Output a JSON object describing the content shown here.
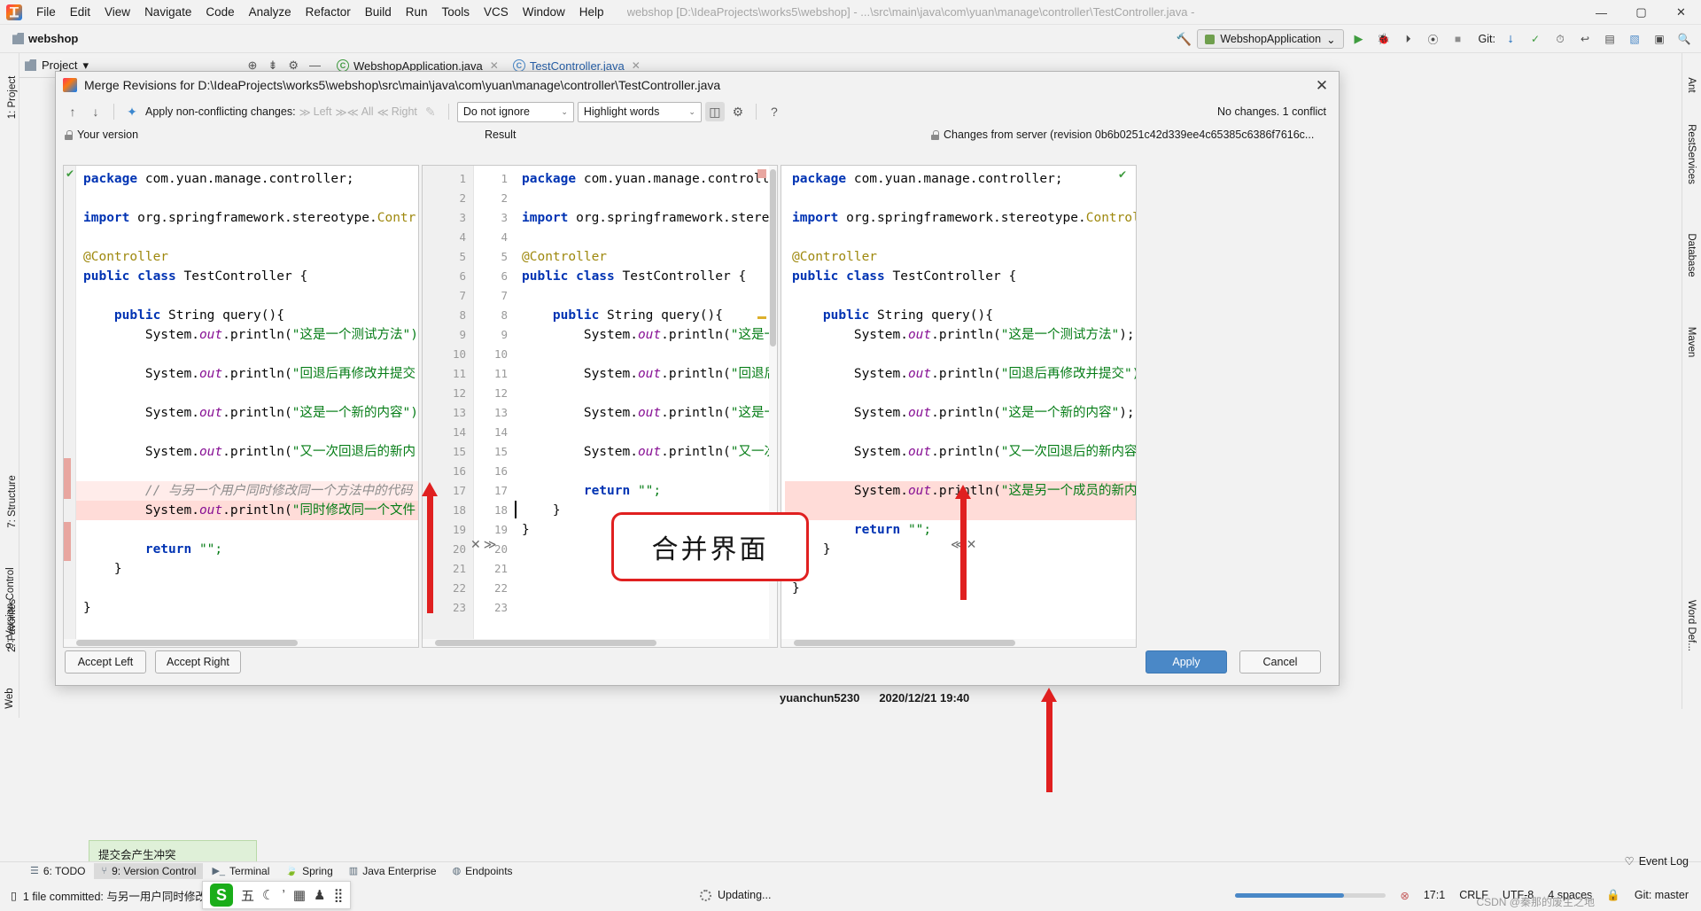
{
  "menubar": {
    "logo_icon": "intellij-logo-icon",
    "items": [
      "File",
      "Edit",
      "View",
      "Navigate",
      "Code",
      "Analyze",
      "Refactor",
      "Build",
      "Run",
      "Tools",
      "VCS",
      "Window",
      "Help"
    ],
    "window_title": "webshop [D:\\IdeaProjects\\works5\\webshop] - ...\\src\\main\\java\\com\\yuan\\manage\\controller\\TestController.java - IntelliJ IDEA",
    "minimize": "—",
    "maximize": "▢",
    "close": "✕"
  },
  "navbar": {
    "breadcrumb": "webshop",
    "run_config": "WebshopApplication",
    "git_label": "Git:",
    "icons": [
      "hammer-icon",
      "run-icon",
      "debug-icon",
      "coverage-icon",
      "profile-icon",
      "stop-icon",
      "git-update-icon",
      "git-commit-icon",
      "git-history-icon",
      "git-revert-icon",
      "search-everywhere-icon",
      "settings-icon"
    ]
  },
  "project_tool": {
    "title": "Project",
    "caret": "▾"
  },
  "editor_tabs": [
    {
      "label": "WebshopApplication.java",
      "icon": "java-class-icon",
      "active": false,
      "close": "✕"
    },
    {
      "label": "TestController.java",
      "icon": "java-class-icon",
      "active": true,
      "close": "✕"
    }
  ],
  "left_strip": [
    "1: Project",
    "7: Structure",
    "9: Version Control",
    "2: Favorites",
    "Web"
  ],
  "left_strip_bottom_labels": [
    "7: Structure",
    "2: Favorites"
  ],
  "right_strip": [
    "Ant",
    "RestServices",
    "Database",
    "Maven"
  ],
  "right_strip_bottom": [
    "Word Def..."
  ],
  "dialog": {
    "title": "Merge Revisions for D:\\IdeaProjects\\works5\\webshop\\src\\main\\java\\com\\yuan\\manage\\controller\\TestController.java",
    "logo_icon": "intellij-logo-icon",
    "close_icon": "✕",
    "toolbar": {
      "prev_icon": "arrow-up-icon",
      "next_icon": "arrow-down-icon",
      "magic_icon": "apply-all-icon",
      "apply_label": "Apply non-conflicting changes:",
      "left_label": "Left",
      "all_label": "All",
      "right_label": "Right",
      "wand_icon": "magic-wand-icon",
      "ignore_select": "Do not ignore",
      "highlight_select": "Highlight words",
      "columns_icon": "collapse-unchanged-icon",
      "gear_icon": "gear-icon",
      "help_icon": "?",
      "conflict_status": "No changes. 1 conflict"
    },
    "panes": {
      "left_title": "Your version",
      "left_lock_icon": "lock-icon",
      "result_title": "Result",
      "right_title": "Changes from server (revision 0b6b0251c42d339ee4c65385c6386f7616c...",
      "right_lock_icon": "lock-icon"
    },
    "buttons": {
      "accept_left": "Accept Left",
      "accept_right": "Accept Right",
      "apply": "Apply",
      "cancel": "Cancel"
    },
    "conflict_actions": {
      "left_x": "✕",
      "left_chevrons": "≫",
      "right_chevrons": "≪",
      "right_x": "✕"
    }
  },
  "code": {
    "left_lines": [
      {
        "n": "",
        "segs": [
          {
            "t": "package ",
            "c": "kw"
          },
          {
            "t": "com.yuan.manage.controller;",
            "c": "pln"
          }
        ]
      },
      {
        "n": "",
        "segs": []
      },
      {
        "n": "",
        "segs": [
          {
            "t": "import ",
            "c": "kw"
          },
          {
            "t": "org.springframework.stereotype.",
            "c": "pln"
          },
          {
            "t": "Contr",
            "c": "ann"
          }
        ]
      },
      {
        "n": "",
        "segs": []
      },
      {
        "n": "",
        "segs": [
          {
            "t": "@Controller",
            "c": "ann"
          }
        ]
      },
      {
        "n": "",
        "segs": [
          {
            "t": "public class ",
            "c": "kw"
          },
          {
            "t": "TestController {",
            "c": "pln"
          }
        ]
      },
      {
        "n": "",
        "segs": []
      },
      {
        "n": "",
        "segs": [
          {
            "t": "    public ",
            "c": "kw"
          },
          {
            "t": "String query(){",
            "c": "pln"
          }
        ]
      },
      {
        "n": "",
        "segs": [
          {
            "t": "        System.",
            "c": "pln"
          },
          {
            "t": "out",
            "c": "fld"
          },
          {
            "t": ".println(",
            "c": "pln"
          },
          {
            "t": "\"这是一个测试方法\")",
            "c": "str"
          }
        ]
      },
      {
        "n": "",
        "segs": []
      },
      {
        "n": "",
        "segs": [
          {
            "t": "        System.",
            "c": "pln"
          },
          {
            "t": "out",
            "c": "fld"
          },
          {
            "t": ".println(",
            "c": "pln"
          },
          {
            "t": "\"回退后再修改并提交",
            "c": "str"
          }
        ]
      },
      {
        "n": "",
        "segs": []
      },
      {
        "n": "",
        "segs": [
          {
            "t": "        System.",
            "c": "pln"
          },
          {
            "t": "out",
            "c": "fld"
          },
          {
            "t": ".println(",
            "c": "pln"
          },
          {
            "t": "\"这是一个新的内容\")",
            "c": "str"
          }
        ]
      },
      {
        "n": "",
        "segs": []
      },
      {
        "n": "",
        "segs": [
          {
            "t": "        System.",
            "c": "pln"
          },
          {
            "t": "out",
            "c": "fld"
          },
          {
            "t": ".println(",
            "c": "pln"
          },
          {
            "t": "\"又一次回退后的新内",
            "c": "str"
          }
        ]
      },
      {
        "n": "",
        "segs": []
      },
      {
        "n": "",
        "segs": [
          {
            "t": "        // 与另一个用户同时修改同一个方法中的代码",
            "c": "cmt"
          }
        ],
        "hl": "soft"
      },
      {
        "n": "",
        "segs": [
          {
            "t": "        System.",
            "c": "pln"
          },
          {
            "t": "out",
            "c": "fld"
          },
          {
            "t": ".println(",
            "c": "pln"
          },
          {
            "t": "\"同时修改同一个文件",
            "c": "str"
          }
        ],
        "hl": "hard"
      },
      {
        "n": "",
        "segs": []
      },
      {
        "n": "",
        "segs": [
          {
            "t": "        return ",
            "c": "kw"
          },
          {
            "t": "\"\";",
            "c": "str"
          }
        ]
      },
      {
        "n": "",
        "segs": [
          {
            "t": "    }",
            "c": "pln"
          }
        ]
      },
      {
        "n": "",
        "segs": []
      },
      {
        "n": "",
        "segs": [
          {
            "t": "}",
            "c": "pln"
          }
        ]
      }
    ],
    "result_lines": [
      {
        "n": "1",
        "segs": [
          {
            "t": "package ",
            "c": "kw"
          },
          {
            "t": "com.yuan.manage.controller;",
            "c": "pln"
          }
        ]
      },
      {
        "n": "2",
        "segs": []
      },
      {
        "n": "3",
        "segs": [
          {
            "t": "import ",
            "c": "kw"
          },
          {
            "t": "org.springframework.stereotype.",
            "c": "pln"
          },
          {
            "t": "Controll",
            "c": "ann"
          }
        ]
      },
      {
        "n": "4",
        "segs": []
      },
      {
        "n": "5",
        "segs": [
          {
            "t": "@Controller",
            "c": "ann"
          }
        ]
      },
      {
        "n": "6",
        "segs": [
          {
            "t": "public class ",
            "c": "kw"
          },
          {
            "t": "TestController {",
            "c": "pln"
          }
        ]
      },
      {
        "n": "7",
        "segs": []
      },
      {
        "n": "8",
        "segs": [
          {
            "t": "    public ",
            "c": "kw"
          },
          {
            "t": "String query(){",
            "c": "pln"
          }
        ]
      },
      {
        "n": "9",
        "segs": [
          {
            "t": "        System.",
            "c": "pln"
          },
          {
            "t": "out",
            "c": "fld"
          },
          {
            "t": ".println(",
            "c": "pln"
          },
          {
            "t": "\"这是一个测试方法\"",
            "c": "str"
          },
          {
            "t": ");",
            "c": "pln"
          }
        ]
      },
      {
        "n": "10",
        "segs": []
      },
      {
        "n": "11",
        "segs": [
          {
            "t": "        System.",
            "c": "pln"
          },
          {
            "t": "out",
            "c": "fld"
          },
          {
            "t": ".println(",
            "c": "pln"
          },
          {
            "t": "\"回退后再修改并提交\"",
            "c": "str"
          },
          {
            "t": ");",
            "c": "pln"
          }
        ]
      },
      {
        "n": "12",
        "segs": []
      },
      {
        "n": "13",
        "segs": [
          {
            "t": "        System.",
            "c": "pln"
          },
          {
            "t": "out",
            "c": "fld"
          },
          {
            "t": ".println(",
            "c": "pln"
          },
          {
            "t": "\"这是一个新的内容\"",
            "c": "str"
          },
          {
            "t": ");",
            "c": "pln"
          }
        ]
      },
      {
        "n": "14",
        "segs": []
      },
      {
        "n": "15",
        "segs": [
          {
            "t": "        System.",
            "c": "pln"
          },
          {
            "t": "out",
            "c": "fld"
          },
          {
            "t": ".println(",
            "c": "pln"
          },
          {
            "t": "\"又一次回退后的新内容\"",
            "c": "str"
          }
        ]
      },
      {
        "n": "16",
        "segs": []
      },
      {
        "n": "17",
        "segs": [
          {
            "t": "        return ",
            "c": "kw"
          },
          {
            "t": "\"\";",
            "c": "str"
          }
        ]
      },
      {
        "n": "18",
        "segs": [
          {
            "t": "    }",
            "c": "pln"
          }
        ]
      },
      {
        "n": "19",
        "segs": [
          {
            "t": "}",
            "c": "pln"
          }
        ]
      },
      {
        "n": "20",
        "segs": []
      },
      {
        "n": "21",
        "segs": []
      },
      {
        "n": "22",
        "segs": []
      },
      {
        "n": "23",
        "segs": []
      }
    ],
    "right_lines": [
      {
        "n": "1",
        "segs": [
          {
            "t": "package ",
            "c": "kw"
          },
          {
            "t": "com.yuan.manage.controller;",
            "c": "pln"
          }
        ]
      },
      {
        "n": "2",
        "segs": []
      },
      {
        "n": "3",
        "segs": [
          {
            "t": "import ",
            "c": "kw"
          },
          {
            "t": "org.springframework.stereotype.",
            "c": "pln"
          },
          {
            "t": "Control",
            "c": "ann"
          }
        ]
      },
      {
        "n": "4",
        "segs": []
      },
      {
        "n": "5",
        "segs": [
          {
            "t": "@Controller",
            "c": "ann"
          }
        ]
      },
      {
        "n": "6",
        "segs": [
          {
            "t": "public class ",
            "c": "kw"
          },
          {
            "t": "TestController {",
            "c": "pln"
          }
        ]
      },
      {
        "n": "7",
        "segs": []
      },
      {
        "n": "8",
        "segs": [
          {
            "t": "    public ",
            "c": "kw"
          },
          {
            "t": "String query(){",
            "c": "pln"
          }
        ]
      },
      {
        "n": "9",
        "segs": [
          {
            "t": "        System.",
            "c": "pln"
          },
          {
            "t": "out",
            "c": "fld"
          },
          {
            "t": ".println(",
            "c": "pln"
          },
          {
            "t": "\"这是一个测试方法\"",
            "c": "str"
          },
          {
            "t": ");",
            "c": "pln"
          }
        ]
      },
      {
        "n": "10",
        "segs": []
      },
      {
        "n": "11",
        "segs": [
          {
            "t": "        System.",
            "c": "pln"
          },
          {
            "t": "out",
            "c": "fld"
          },
          {
            "t": ".println(",
            "c": "pln"
          },
          {
            "t": "\"回退后再修改并提交\")",
            "c": "str"
          }
        ]
      },
      {
        "n": "12",
        "segs": []
      },
      {
        "n": "13",
        "segs": [
          {
            "t": "        System.",
            "c": "pln"
          },
          {
            "t": "out",
            "c": "fld"
          },
          {
            "t": ".println(",
            "c": "pln"
          },
          {
            "t": "\"这是一个新的内容\"",
            "c": "str"
          },
          {
            "t": ");",
            "c": "pln"
          }
        ]
      },
      {
        "n": "14",
        "segs": []
      },
      {
        "n": "15",
        "segs": [
          {
            "t": "        System.",
            "c": "pln"
          },
          {
            "t": "out",
            "c": "fld"
          },
          {
            "t": ".println(",
            "c": "pln"
          },
          {
            "t": "\"又一次回退后的新内容",
            "c": "str"
          }
        ]
      },
      {
        "n": "16",
        "segs": []
      },
      {
        "n": "17",
        "segs": [
          {
            "t": "        System.",
            "c": "pln"
          },
          {
            "t": "out",
            "c": "fld"
          },
          {
            "t": ".println(",
            "c": "pln"
          },
          {
            "t": "\"这是另一个成员的新内",
            "c": "str"
          }
        ],
        "hl": "hard"
      },
      {
        "n": "18",
        "segs": [],
        "hl": "hard"
      },
      {
        "n": "19",
        "segs": [
          {
            "t": "        return ",
            "c": "kw"
          },
          {
            "t": "\"\";",
            "c": "str"
          }
        ]
      },
      {
        "n": "20",
        "segs": [
          {
            "t": "    }",
            "c": "pln"
          }
        ]
      },
      {
        "n": "21",
        "segs": []
      },
      {
        "n": "22",
        "segs": [
          {
            "t": "}",
            "c": "pln"
          }
        ]
      }
    ]
  },
  "annotations": {
    "callout_text": "合并界面",
    "callout_color": "#e02020",
    "arrow_color": "#e02020"
  },
  "commit_info": {
    "user": "yuanchun5230",
    "datetime": "2020/12/21 19:40"
  },
  "balloon": {
    "text": "提交会产生冲突"
  },
  "tool_windows": [
    {
      "label": "6: TODO",
      "icon": "todo-icon",
      "active": false
    },
    {
      "label": "9: Version Control",
      "icon": "branch-icon",
      "active": true
    },
    {
      "label": "Terminal",
      "icon": "terminal-icon",
      "active": false
    },
    {
      "label": "Spring",
      "icon": "spring-leaf-icon",
      "active": false
    },
    {
      "label": "Java Enterprise",
      "icon": "java-ee-icon",
      "active": false
    },
    {
      "label": "Endpoints",
      "icon": "endpoints-icon",
      "active": false
    }
  ],
  "statusbar": {
    "commit_icon": "document-icon",
    "commit_text": "1 file committed: 与另一用户同时修改同一个文件 (a minute ago)",
    "updating_text": "Updating...",
    "updating_icon": "spinner-icon",
    "caret_position": "17:1",
    "line_separator": "CRLF",
    "encoding": "UTF-8",
    "indent": "4 spaces",
    "git_branch": "Git: master",
    "lock_icon": "lock-icon",
    "event_log": "Event Log",
    "event_log_icon": "event-log-icon",
    "progress_percent": 72
  },
  "ime": {
    "logo": "S",
    "keys": [
      "五",
      "☾",
      "ʼ",
      "▦",
      "♟",
      "⣿"
    ]
  },
  "watermark": "CSDN @秦那的废生之地"
}
